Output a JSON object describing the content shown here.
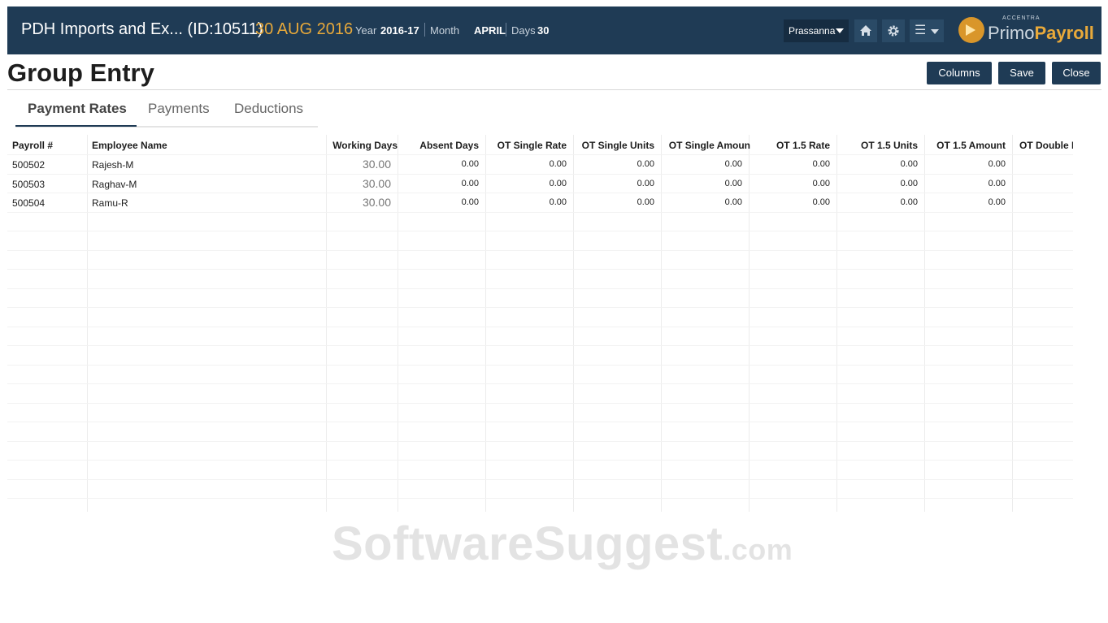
{
  "header": {
    "company": "PDH Imports and Ex... (ID:10511)",
    "date": "30 AUG 2016",
    "year_label": "Year",
    "year_value": "2016-17",
    "month_label": "Month",
    "month_value": "APRIL",
    "days_label": "Days",
    "days_value": "30",
    "user": "Prassanna",
    "home_icon": "home-icon",
    "settings_icon": "gear-icon",
    "menu_icon": "hamburger-menu-icon",
    "brand_top": "ACCENTRA",
    "brand_part1": "Primo",
    "brand_part2": "Payroll",
    "colors": {
      "bar": "#1f3b55",
      "accent": "#e8a93a"
    }
  },
  "page": {
    "title": "Group Entry",
    "buttons": {
      "columns": "Columns",
      "save": "Save",
      "close": "Close"
    }
  },
  "tabs": [
    "Payment Rates",
    "Payments",
    "Deductions"
  ],
  "grid": {
    "columns": [
      "Payroll #",
      "Employee Name",
      "Working Days",
      "Absent Days",
      "OT Single Rate",
      "OT Single Units",
      "OT Single Amoun",
      "OT 1.5 Rate",
      "OT 1.5 Units",
      "OT 1.5 Amount",
      "OT Double R"
    ],
    "rows": [
      {
        "payroll": "500502",
        "name": "Rajesh-M",
        "working_days": "30.00",
        "values": [
          "0.00",
          "0.00",
          "0.00",
          "0.00",
          "0.00",
          "0.00",
          "0.00"
        ]
      },
      {
        "payroll": "500503",
        "name": "Raghav-M",
        "working_days": "30.00",
        "values": [
          "0.00",
          "0.00",
          "0.00",
          "0.00",
          "0.00",
          "0.00",
          "0.00"
        ]
      },
      {
        "payroll": "500504",
        "name": "Ramu-R",
        "working_days": "30.00",
        "values": [
          "0.00",
          "0.00",
          "0.00",
          "0.00",
          "0.00",
          "0.00",
          "0.00"
        ]
      }
    ]
  },
  "watermark": {
    "main": "SoftwareSuggest",
    "suffix": ".com"
  }
}
